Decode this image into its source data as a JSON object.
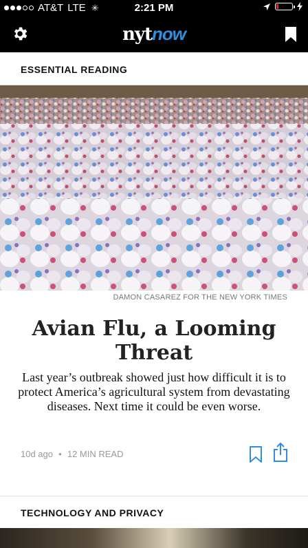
{
  "status_bar": {
    "carrier": "AT&T",
    "network": "LTE",
    "time": "2:21 PM",
    "signal_bars": 3,
    "signal_max": 5,
    "battery_level": 0.12,
    "battery_color": "#e0262a"
  },
  "header": {
    "logo_part1": "nyt",
    "logo_part2": "now",
    "logo_accent": "#2f8ee0",
    "left_icon": "gear-icon",
    "right_icon": "bookmark-icon"
  },
  "sections": [
    {
      "title": "ESSENTIAL READING",
      "article": {
        "photo_credit": "DAMON CASAREZ FOR THE NEW YORK TIMES",
        "headline": "Avian Flu, a Looming Threat",
        "summary": "Last year’s outbreak showed just how difficult it is to protect America’s agricultural system from devastating diseases. Next time it could be even worse.",
        "age": "10d ago",
        "read_time": "12 MIN READ",
        "action_color": "#2f8ee0"
      }
    },
    {
      "title": "TECHNOLOGY AND PRIVACY"
    }
  ]
}
